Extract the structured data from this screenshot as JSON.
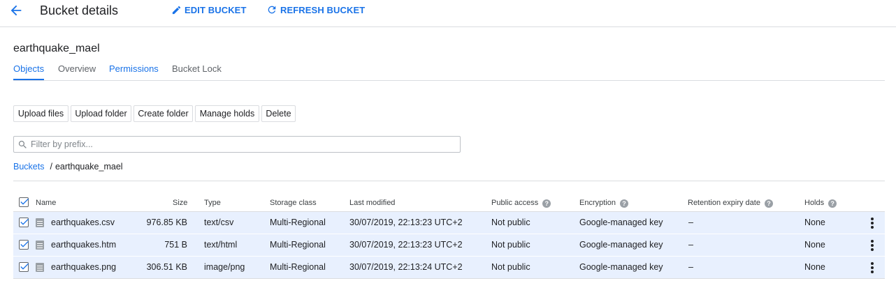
{
  "header": {
    "title": "Bucket details",
    "edit_label": "EDIT BUCKET",
    "refresh_label": "REFRESH BUCKET"
  },
  "bucket": {
    "name": "earthquake_mael"
  },
  "tabs": [
    {
      "label": "Objects",
      "active": true
    },
    {
      "label": "Overview"
    },
    {
      "label": "Permissions"
    },
    {
      "label": "Bucket Lock"
    }
  ],
  "toolbar": {
    "upload_files": "Upload files",
    "upload_folder": "Upload folder",
    "create_folder": "Create folder",
    "manage_holds": "Manage holds",
    "delete": "Delete"
  },
  "filter": {
    "placeholder": "Filter by prefix..."
  },
  "breadcrumb": {
    "root": "Buckets",
    "separator": "/",
    "current": "earthquake_mael"
  },
  "table": {
    "columns": {
      "name": "Name",
      "size": "Size",
      "type": "Type",
      "storage_class": "Storage class",
      "last_modified": "Last modified",
      "public_access": "Public access",
      "encryption": "Encryption",
      "retention": "Retention expiry date",
      "holds": "Holds"
    },
    "rows": [
      {
        "name": "earthquakes.csv",
        "size": "976.85 KB",
        "type": "text/csv",
        "storage_class": "Multi-Regional",
        "last_modified": "30/07/2019, 22:13:23 UTC+2",
        "public_access": "Not public",
        "encryption": "Google-managed key",
        "retention": "–",
        "holds": "None",
        "checked": true
      },
      {
        "name": "earthquakes.htm",
        "size": "751 B",
        "type": "text/html",
        "storage_class": "Multi-Regional",
        "last_modified": "30/07/2019, 22:13:23 UTC+2",
        "public_access": "Not public",
        "encryption": "Google-managed key",
        "retention": "–",
        "holds": "None",
        "checked": true
      },
      {
        "name": "earthquakes.png",
        "size": "306.51 KB",
        "type": "image/png",
        "storage_class": "Multi-Regional",
        "last_modified": "30/07/2019, 22:13:24 UTC+2",
        "public_access": "Not public",
        "encryption": "Google-managed key",
        "retention": "–",
        "holds": "None",
        "checked": true
      }
    ]
  },
  "colors": {
    "accent": "#1a73e8",
    "row_selected": "#e8f0fe",
    "divider": "#dadce0"
  },
  "icons": {
    "back": "arrow-back-icon",
    "edit": "pencil-icon",
    "refresh": "refresh-icon",
    "search": "search-icon",
    "help": "help-icon",
    "file": "file-icon",
    "more": "more-vert-icon"
  }
}
